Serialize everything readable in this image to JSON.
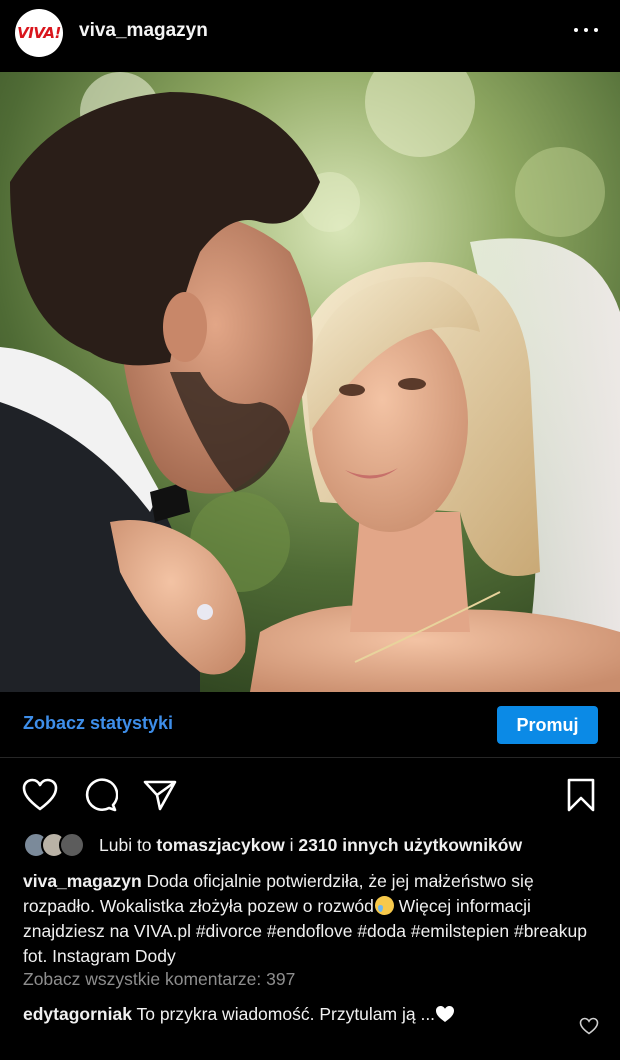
{
  "header": {
    "avatar_text": "VIVA!",
    "username": "viva_magazyn",
    "more_icon": "more-dots-icon"
  },
  "photo": {
    "alt_subject": "wedding couple photo"
  },
  "stats": {
    "link_label": "Zobacz statystyki",
    "promote_label": "Promuj",
    "promote_color": "#0b8ae6"
  },
  "actions": {
    "like_icon": "heart-icon",
    "comment_icon": "comment-icon",
    "share_icon": "send-icon",
    "save_icon": "bookmark-icon"
  },
  "likes": {
    "prefix": "Lubi to ",
    "user": "tomaszjacykow",
    "connector": " i ",
    "others": "2310 innych użytkowników"
  },
  "caption": {
    "username": "viva_magazyn",
    "text_part1": " Doda oficjalnie potwierdziła, że jej małżeństwo się rozpadło. Wokalistka złożyła pozew o rozwód",
    "text_part2": " Więcej informacji znajdziesz na VIVA.pl #divorce #endoflove #doda #emilstepien #breakup fot. Instagram Dody"
  },
  "comments": {
    "view_all_label": "Zobacz wszystkie komentarze: 397",
    "items": [
      {
        "username": "edytagorniak",
        "text": " To przykra wiadomość. Przytulam ją ..."
      }
    ]
  }
}
